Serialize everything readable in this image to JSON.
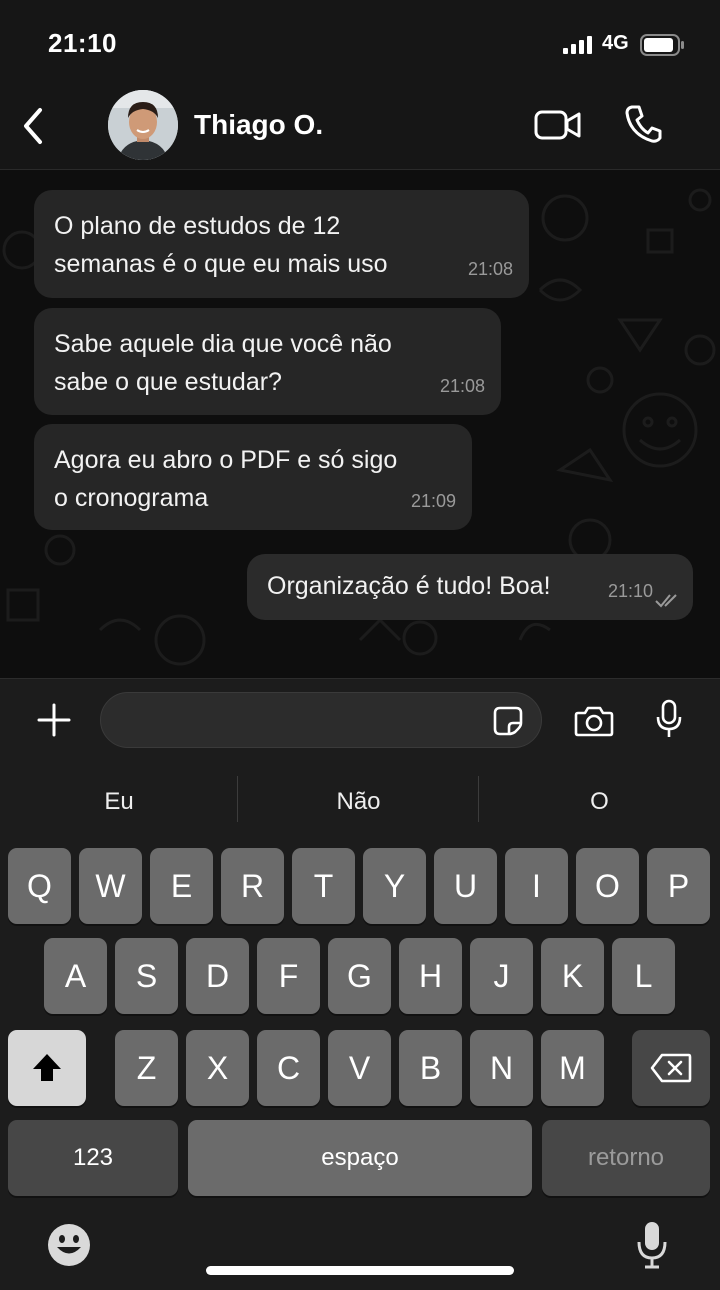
{
  "status_bar": {
    "time": "21:10",
    "network": "4G",
    "icons": [
      "signal-icon",
      "battery-icon"
    ]
  },
  "header": {
    "contact_name": "Thiago O.",
    "icons": [
      "back-chevron-icon",
      "video-camera-icon",
      "phone-icon"
    ]
  },
  "messages": [
    {
      "direction": "incoming",
      "lines": [
        "O plano de estudos de 12",
        "semanas é o que eu mais uso"
      ],
      "time": "21:08"
    },
    {
      "direction": "incoming",
      "lines": [
        "Sabe aquele dia que você não",
        "sabe o que estudar?"
      ],
      "time": "21:08"
    },
    {
      "direction": "incoming",
      "lines": [
        "Agora eu abro o PDF e só sigo",
        "o cronograma"
      ],
      "time": "21:09"
    },
    {
      "direction": "outgoing",
      "lines": [
        "Organização é tudo! Boa!"
      ],
      "time": "21:10",
      "status": "read"
    }
  ],
  "input": {
    "value": "",
    "icons": [
      "plus-icon",
      "sticker-icon",
      "camera-icon",
      "microphone-icon"
    ]
  },
  "keyboard": {
    "suggestions": [
      "Eu",
      "Não",
      "O"
    ],
    "row1": [
      "Q",
      "W",
      "E",
      "R",
      "T",
      "Y",
      "U",
      "I",
      "O",
      "P"
    ],
    "row2": [
      "A",
      "S",
      "D",
      "F",
      "G",
      "H",
      "J",
      "K",
      "L"
    ],
    "row3": [
      "Z",
      "X",
      "C",
      "V",
      "B",
      "N",
      "M"
    ],
    "numbers_key": "123",
    "space_key": "espaço",
    "return_key": "retorno",
    "icons": [
      "shift-icon",
      "backspace-icon",
      "emoji-icon",
      "dictation-mic-icon"
    ]
  },
  "colors": {
    "incoming_bubble": "#262626",
    "outgoing_bubble": "#2b2b2b",
    "background": "#0e0e0e",
    "read_ticks": "#9a9a9a"
  }
}
